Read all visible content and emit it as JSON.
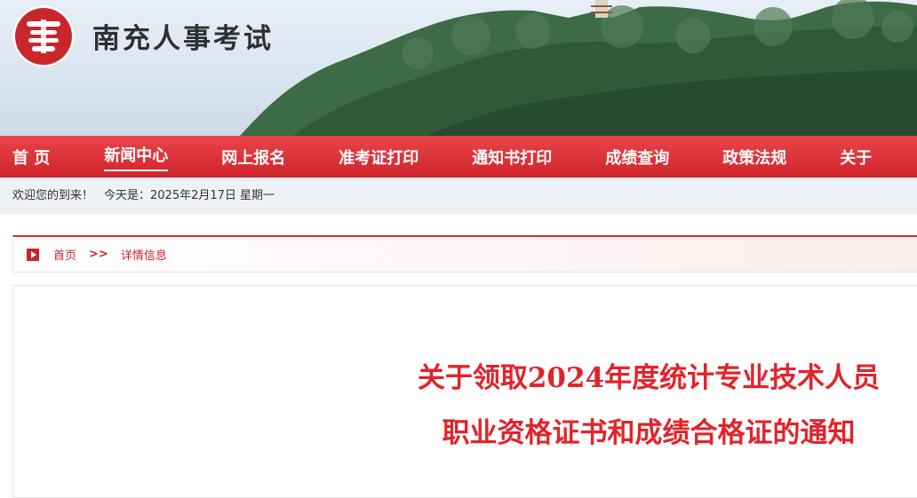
{
  "header": {
    "site_title": "南充人事考试",
    "logo_icon": "seal-logo-icon"
  },
  "nav": {
    "items": [
      {
        "label": "首 页"
      },
      {
        "label": "新闻中心"
      },
      {
        "label": "网上报名"
      },
      {
        "label": "准考证打印"
      },
      {
        "label": "通知书打印"
      },
      {
        "label": "成绩查询"
      },
      {
        "label": "政策法规"
      },
      {
        "label": "关于"
      }
    ],
    "active_index": 1
  },
  "welcome": {
    "greeting": "欢迎您的到来！",
    "date_text": "今天是：2025年2月17日 星期一"
  },
  "breadcrumb": {
    "home": "首页",
    "separator": ">>",
    "current": "详情信息"
  },
  "article": {
    "title_line1": "关于领取2024年度统计专业技术人员",
    "title_line2": "职业资格证书和成绩合格证的通知"
  },
  "colors": {
    "brand_red": "#d0242b",
    "title_red": "#e3232a"
  }
}
